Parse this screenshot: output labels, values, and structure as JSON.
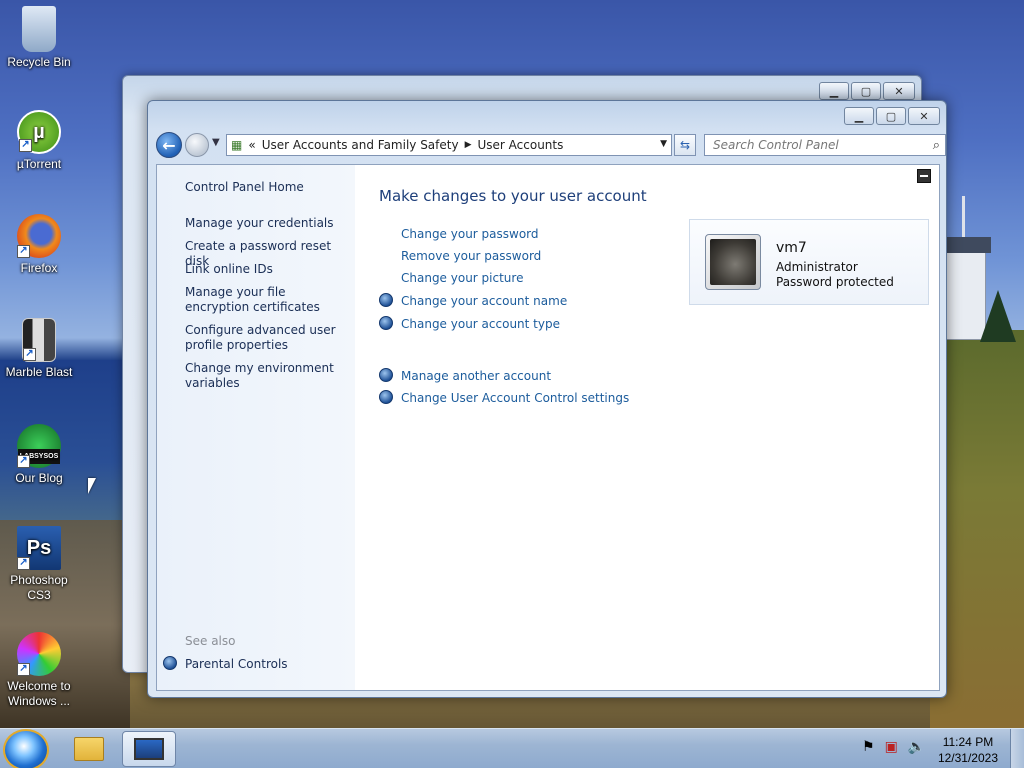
{
  "desktop": {
    "icons": [
      {
        "label": "Recycle Bin",
        "icon": "recycle-bin-icon"
      },
      {
        "label": "µTorrent",
        "icon": "utorrent-icon"
      },
      {
        "label": "Firefox",
        "icon": "firefox-icon"
      },
      {
        "label": "Marble Blast",
        "icon": "marble-blast-icon"
      },
      {
        "label": "Our Blog",
        "icon": "our-blog-icon",
        "badge": "LABSYSOS"
      },
      {
        "label": "Photoshop CS3",
        "icon": "photoshop-icon",
        "glyph": "Ps"
      },
      {
        "label": "Welcome to Windows ...",
        "icon": "welcome-icon"
      }
    ]
  },
  "window": {
    "breadcrumb": {
      "chevrons": "«",
      "items": [
        "User Accounts and Family Safety",
        "User Accounts"
      ]
    },
    "search_placeholder": "Search Control Panel",
    "left_pane": {
      "home": "Control Panel Home",
      "tasks": [
        "Manage your credentials",
        "Create a password reset disk",
        "Link online IDs",
        "Manage your file encryption certificates",
        "Configure advanced user profile properties",
        "Change my environment variables"
      ],
      "see_also_label": "See also",
      "see_also": [
        "Parental Controls"
      ]
    },
    "main": {
      "heading": "Make changes to your user account",
      "links": [
        {
          "label": "Change your password",
          "shield": false
        },
        {
          "label": "Remove your password",
          "shield": false
        },
        {
          "label": "Change your picture",
          "shield": false
        },
        {
          "label": "Change your account name",
          "shield": true
        },
        {
          "label": "Change your account type",
          "shield": true
        }
      ],
      "links2": [
        {
          "label": "Manage another account",
          "shield": true
        },
        {
          "label": "Change User Account Control settings",
          "shield": true
        }
      ]
    },
    "account": {
      "name": "vm7",
      "role": "Administrator",
      "status": "Password protected"
    }
  },
  "taskbar": {
    "time": "11:24 PM",
    "date": "12/31/2023"
  }
}
